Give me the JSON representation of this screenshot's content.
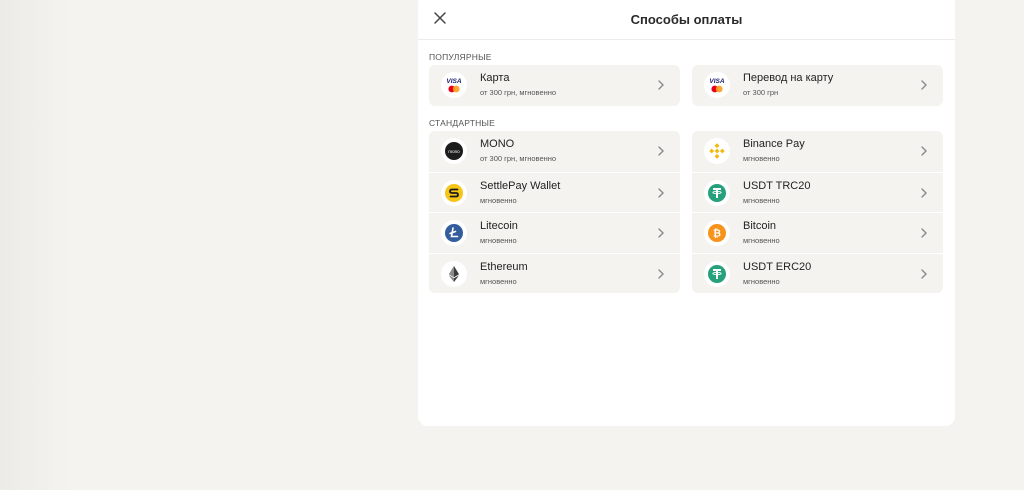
{
  "modal": {
    "title": "Способы оплаты",
    "close_icon": "close-icon"
  },
  "sections": {
    "popular": {
      "label": "ПОПУЛЯРНЫЕ",
      "left": [
        {
          "name": "Карта",
          "sub": "от 300 грн, мгновенно",
          "icon": "visa-mastercard-icon"
        }
      ],
      "right": [
        {
          "name": "Перевод на карту",
          "sub": "от 300 грн",
          "icon": "visa-mastercard-icon"
        }
      ]
    },
    "standard": {
      "label": "СТАНДАРТНЫЕ",
      "left": [
        {
          "name": "MONO",
          "sub": "от 300 грн, мгновенно",
          "icon": "mono-icon"
        },
        {
          "name": "SettlePay Wallet",
          "sub": "мгновенно",
          "icon": "settlepay-icon"
        },
        {
          "name": "Litecoin",
          "sub": "мгновенно",
          "icon": "litecoin-icon"
        },
        {
          "name": "Ethereum",
          "sub": "мгновенно",
          "icon": "ethereum-icon"
        }
      ],
      "right": [
        {
          "name": "Binance Pay",
          "sub": "мгновенно",
          "icon": "binance-icon"
        },
        {
          "name": "USDT TRC20",
          "sub": "мгновенно",
          "icon": "tether-icon"
        },
        {
          "name": "Bitcoin",
          "sub": "мгновенно",
          "icon": "bitcoin-icon"
        },
        {
          "name": "USDT ERC20",
          "sub": "мгновенно",
          "icon": "tether-icon"
        }
      ]
    }
  },
  "colors": {
    "page_bg": "#f4f3ef",
    "card_bg": "#f4f3ef",
    "visa_blue": "#1a1f71",
    "mastercard_red": "#eb001b",
    "mastercard_yellow": "#f79e1b",
    "binance": "#f0b90b",
    "tether": "#26a17b",
    "bitcoin": "#f7931a",
    "litecoin": "#345d9d",
    "settlepay": "#f5c518"
  }
}
